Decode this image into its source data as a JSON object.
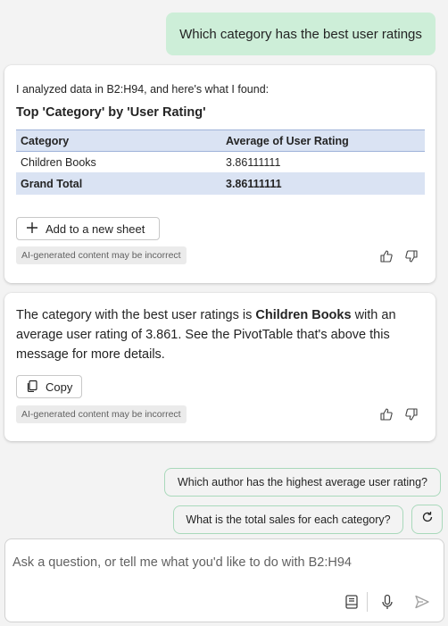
{
  "user_message": "Which category has the best user ratings",
  "response1": {
    "intro": "I analyzed data in B2:H94, and here's what I found:",
    "table_title": "Top 'Category' by 'User Rating'",
    "headers": [
      "Category",
      "Average of User Rating"
    ],
    "rows": [
      [
        "Children Books",
        "3.86111111"
      ]
    ],
    "total": [
      "Grand Total",
      "3.86111111"
    ],
    "add_button": "Add to a new sheet",
    "disclaimer": "AI-generated content may be incorrect"
  },
  "response2": {
    "text_before": "The category with the best user ratings is ",
    "bold": "Children Books",
    "text_after": " with an average user rating of 3.861. See the PivotTable that's above this message for more details.",
    "copy_button": "Copy",
    "disclaimer": "AI-generated content may be incorrect"
  },
  "suggestions": [
    "Which author has the highest average user rating?",
    "What is the total sales for each category?"
  ],
  "composer": {
    "placeholder": "Ask a question, or tell me what you'd like to do with B2:H94"
  },
  "icons": {
    "plus": "plus-icon",
    "copy": "copy-icon",
    "thumbs_up": "thumbs-up-icon",
    "thumbs_down": "thumbs-down-icon",
    "refresh": "refresh-icon",
    "notes": "notebook-icon",
    "mic": "microphone-icon",
    "send": "send-icon"
  },
  "colors": {
    "user_bubble": "#cdeed8",
    "table_header": "#dae3f3",
    "suggestion_border": "#a9d9bb"
  }
}
